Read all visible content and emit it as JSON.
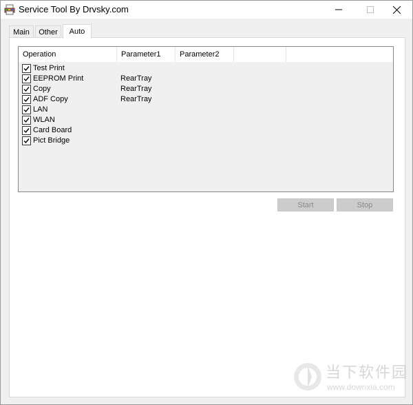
{
  "window": {
    "title": "Service Tool By Drvsky.com",
    "icon": "printer-app-icon"
  },
  "tabs": [
    {
      "label": "Main",
      "selected": false
    },
    {
      "label": "Other",
      "selected": false
    },
    {
      "label": "Auto",
      "selected": true
    }
  ],
  "list": {
    "columns": [
      "Operation",
      "Parameter1",
      "Parameter2",
      "",
      ""
    ],
    "rows": [
      {
        "checked": true,
        "operation": "Test Print",
        "parameter1": ""
      },
      {
        "checked": true,
        "operation": "EEPROM Print",
        "parameter1": "RearTray"
      },
      {
        "checked": true,
        "operation": "Copy",
        "parameter1": "RearTray"
      },
      {
        "checked": true,
        "operation": "ADF Copy",
        "parameter1": "RearTray"
      },
      {
        "checked": true,
        "operation": "LAN",
        "parameter1": ""
      },
      {
        "checked": true,
        "operation": "WLAN",
        "parameter1": ""
      },
      {
        "checked": true,
        "operation": "Card Board",
        "parameter1": ""
      },
      {
        "checked": true,
        "operation": "Pict Bridge",
        "parameter1": ""
      }
    ]
  },
  "buttons": {
    "start": "Start",
    "stop": "Stop"
  },
  "watermark": {
    "text": "当下软件园",
    "url": "www.downxia.com"
  }
}
